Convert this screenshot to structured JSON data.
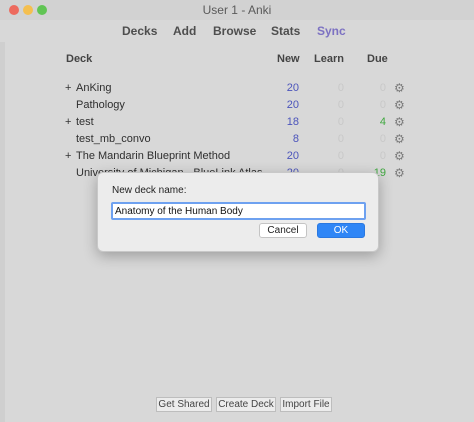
{
  "window": {
    "title": "User 1 - Anki"
  },
  "toolbar": {
    "decks": "Decks",
    "add": "Add",
    "browse": "Browse",
    "stats": "Stats",
    "sync": "Sync"
  },
  "table": {
    "headers": {
      "deck": "Deck",
      "new": "New",
      "learn": "Learn",
      "due": "Due"
    },
    "rows": [
      {
        "expander": "+",
        "name": "AnKing",
        "new": "20",
        "learn": "0",
        "due": "0",
        "due_green": false
      },
      {
        "expander": "",
        "name": "Pathology",
        "new": "20",
        "learn": "0",
        "due": "0",
        "due_green": false
      },
      {
        "expander": "+",
        "name": "test",
        "new": "18",
        "learn": "0",
        "due": "4",
        "due_green": true
      },
      {
        "expander": "",
        "name": "test_mb_convo",
        "new": "8",
        "learn": "0",
        "due": "0",
        "due_green": false
      },
      {
        "expander": "+",
        "name": "The Mandarin Blueprint Method",
        "new": "20",
        "learn": "0",
        "due": "0",
        "due_green": false
      },
      {
        "expander": "",
        "name": "University of Michigan - BlueLink Atlas",
        "new": "20",
        "learn": "0",
        "due": "19",
        "due_green": true
      }
    ]
  },
  "bottom": {
    "get_shared": "Get Shared",
    "create_deck": "Create Deck",
    "import_file": "Import File"
  },
  "dialog": {
    "label": "New deck name:",
    "value": "Anatomy of the Human Body",
    "cancel": "Cancel",
    "ok": "OK"
  },
  "icons": {
    "gear": "gear-icon"
  }
}
